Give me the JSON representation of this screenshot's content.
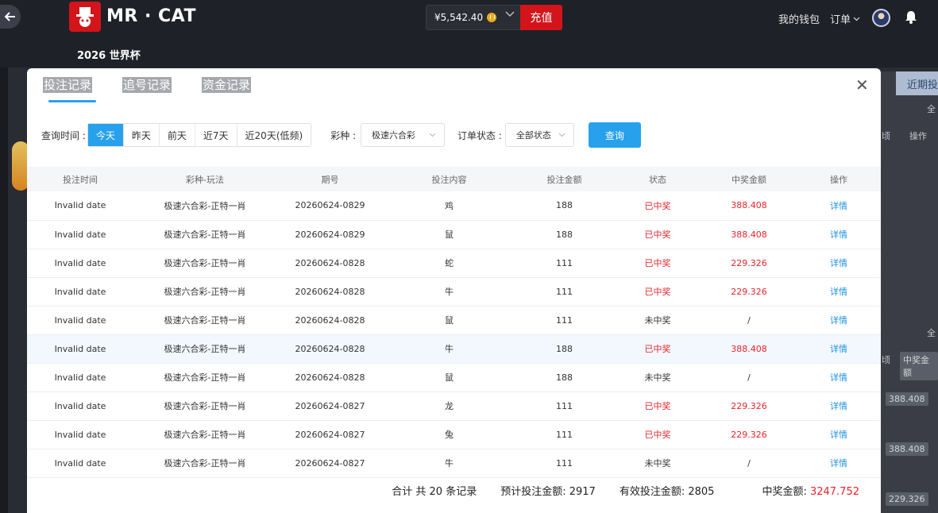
{
  "header": {
    "brand": "MR · CAT",
    "event_title": "2026 世界杯",
    "balance": "¥5,542.40",
    "recharge_label": "充值",
    "wallet_label": "我的钱包",
    "orders_label": "订单"
  },
  "background": {
    "recent_label": "近期投",
    "all_label": "全",
    "col_op": "操作",
    "col_tail": "顷",
    "col_win": "中奖金额",
    "amounts": [
      "388.408",
      "388.408",
      "229.326"
    ]
  },
  "modal": {
    "tabs": [
      "投注记录",
      "追号记录",
      "资金记录"
    ],
    "filters": {
      "time_label": "查询时间 :",
      "time_options": [
        "今天",
        "昨天",
        "前天",
        "近7天",
        "近20天(低频)"
      ],
      "game_label": "彩种 :",
      "game_value": "极速六合彩",
      "status_label": "订单状态 :",
      "status_value": "全部状态",
      "query_label": "查询"
    },
    "columns": [
      "投注时间",
      "彩种-玩法",
      "期号",
      "投注内容",
      "投注金额",
      "状态",
      "中奖金额",
      "操作"
    ],
    "rows": [
      {
        "time": "Invalid date",
        "game": "极速六合彩-正特一肖",
        "issue": "20260624-0829",
        "content": "鸡",
        "amount": "188",
        "status": "已中奖",
        "win": "388.408",
        "op": "详情"
      },
      {
        "time": "Invalid date",
        "game": "极速六合彩-正特一肖",
        "issue": "20260624-0829",
        "content": "鼠",
        "amount": "188",
        "status": "已中奖",
        "win": "388.408",
        "op": "详情"
      },
      {
        "time": "Invalid date",
        "game": "极速六合彩-正特一肖",
        "issue": "20260624-0828",
        "content": "蛇",
        "amount": "111",
        "status": "已中奖",
        "win": "229.326",
        "op": "详情"
      },
      {
        "time": "Invalid date",
        "game": "极速六合彩-正特一肖",
        "issue": "20260624-0828",
        "content": "牛",
        "amount": "111",
        "status": "已中奖",
        "win": "229.326",
        "op": "详情"
      },
      {
        "time": "Invalid date",
        "game": "极速六合彩-正特一肖",
        "issue": "20260624-0828",
        "content": "鼠",
        "amount": "111",
        "status": "未中奖",
        "win": "/",
        "op": "详情"
      },
      {
        "time": "Invalid date",
        "game": "极速六合彩-正特一肖",
        "issue": "20260624-0828",
        "content": "牛",
        "amount": "188",
        "status": "已中奖",
        "win": "388.408",
        "op": "详情"
      },
      {
        "time": "Invalid date",
        "game": "极速六合彩-正特一肖",
        "issue": "20260624-0828",
        "content": "鼠",
        "amount": "188",
        "status": "未中奖",
        "win": "/",
        "op": "详情"
      },
      {
        "time": "Invalid date",
        "game": "极速六合彩-正特一肖",
        "issue": "20260624-0827",
        "content": "龙",
        "amount": "111",
        "status": "已中奖",
        "win": "229.326",
        "op": "详情"
      },
      {
        "time": "Invalid date",
        "game": "极速六合彩-正特一肖",
        "issue": "20260624-0827",
        "content": "兔",
        "amount": "111",
        "status": "已中奖",
        "win": "229.326",
        "op": "详情"
      },
      {
        "time": "Invalid date",
        "game": "极速六合彩-正特一肖",
        "issue": "20260624-0827",
        "content": "牛",
        "amount": "111",
        "status": "未中奖",
        "win": "/",
        "op": "详情"
      }
    ],
    "highlighted_row": 5,
    "summary": {
      "total": "合计 共 20 条记录",
      "expected": "预计投注金额: 2917",
      "valid": "有效投注金额: 2805",
      "win_label": "中奖金额:",
      "win_value": "3247.752"
    }
  },
  "colors": {
    "accent": "#27a1ec",
    "brand_red": "#d3141b",
    "win_red": "#e8242b"
  }
}
